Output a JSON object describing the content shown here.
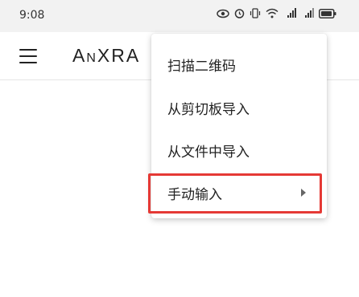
{
  "status_bar": {
    "time": "9:08",
    "icons": [
      "eye-icon",
      "alarm-icon",
      "vibrate-icon",
      "wifi-icon",
      "signal-4g-icon",
      "signal-4g-icon",
      "battery-icon"
    ]
  },
  "app_bar": {
    "title": "AnXRA",
    "menu_icon": "hamburger-menu-icon"
  },
  "dropdown": {
    "items": [
      {
        "label": "扫描二维码"
      },
      {
        "label": "从剪切板导入"
      },
      {
        "label": "从文件中导入"
      },
      {
        "label": "手动输入",
        "has_submenu": true
      }
    ]
  },
  "colors": {
    "highlight": "#e53935",
    "status_bar_bg": "#f2f2f2",
    "text": "#222222"
  }
}
